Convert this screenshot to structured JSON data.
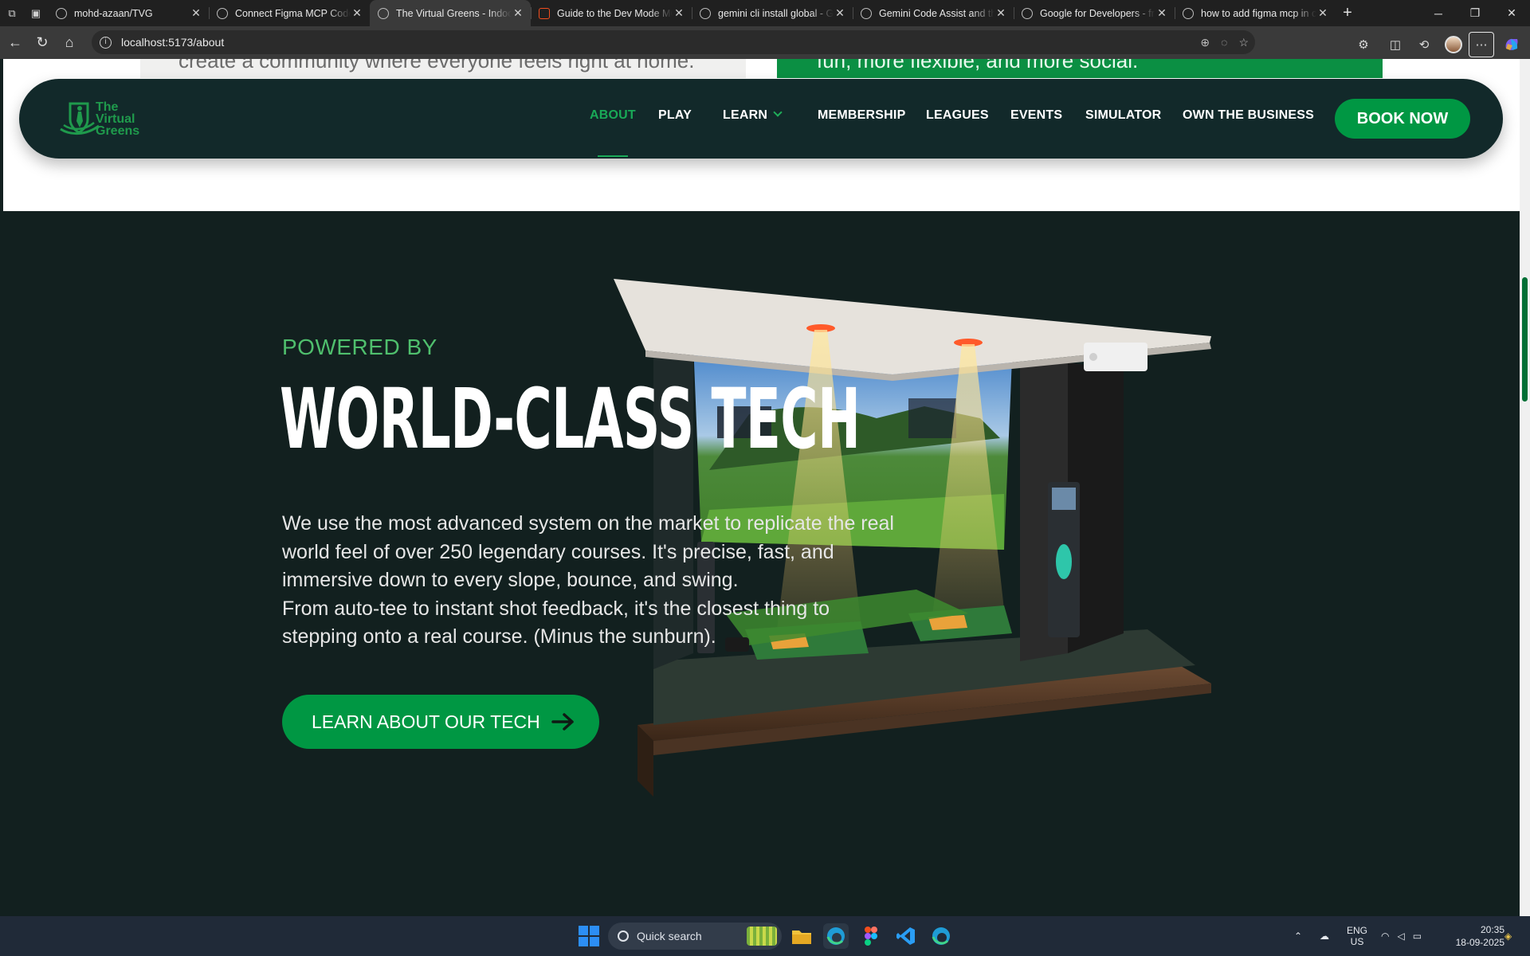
{
  "browser": {
    "tabs": [
      {
        "title": "mohd-azaan/TVG",
        "icon": "github-icon",
        "active": false
      },
      {
        "title": "Connect Figma MCP Code",
        "icon": "openai-icon",
        "active": false
      },
      {
        "title": "The Virtual Greens - Indoor",
        "icon": "globe-icon",
        "active": true
      },
      {
        "title": "Guide to the Dev Mode MCP",
        "icon": "figma-icon",
        "active": false
      },
      {
        "title": "gemini cli install global - G",
        "icon": "google-icon",
        "active": false
      },
      {
        "title": "Gemini Code Assist and th",
        "icon": "google-icon",
        "active": false
      },
      {
        "title": "Google for Developers - fr",
        "icon": "google-icon",
        "active": false
      },
      {
        "title": "how to add figma mcp in c",
        "icon": "google-icon",
        "active": false
      }
    ],
    "url": "localhost:5173/about",
    "new_tab_label": "+"
  },
  "page": {
    "above_fold": {
      "left_card_text": "create a community where everyone feels right at home.",
      "right_card_text": "fun, more flexible, and more social."
    },
    "nav": {
      "logo_text": [
        "The",
        "Virtual",
        "Greens"
      ],
      "items": [
        {
          "label": "ABOUT",
          "active": true
        },
        {
          "label": "PLAY",
          "active": false
        },
        {
          "label": "LEARN",
          "active": false,
          "has_dropdown": true
        },
        {
          "label": "MEMBERSHIP",
          "active": false
        },
        {
          "label": "LEAGUES",
          "active": false
        },
        {
          "label": "EVENTS",
          "active": false
        },
        {
          "label": "SIMULATOR",
          "active": false
        },
        {
          "label": "OWN THE BUSINESS",
          "active": false
        }
      ],
      "cta_label": "BOOK NOW"
    },
    "hero": {
      "kicker": "POWERED BY",
      "headline": "WORLD-CLASS TECH",
      "body_lines": [
        "We use the most advanced system on the market to replicate the real",
        "world feel of over 250 legendary courses. It's precise, fast, and",
        "immersive down to every slope, bounce, and swing.",
        "From auto-tee to instant shot feedback, it's the closest thing to",
        "stepping onto a real course. (Minus the sunburn)."
      ],
      "cta_label": "LEARN ABOUT OUR TECH",
      "image": "golf-simulator-bay"
    },
    "colors": {
      "brand_green": "#009743",
      "nav_bg": "#12292a",
      "section_bg": "#12201f",
      "kicker_green": "#4fbf6d"
    }
  },
  "taskbar": {
    "search_placeholder": "Quick search",
    "apps": [
      "file-explorer-icon",
      "edge-icon",
      "figma-icon",
      "vscode-icon",
      "edge-icon"
    ],
    "lang_top": "ENG",
    "lang_bottom": "US",
    "time": "20:35",
    "date": "18-09-2025"
  }
}
